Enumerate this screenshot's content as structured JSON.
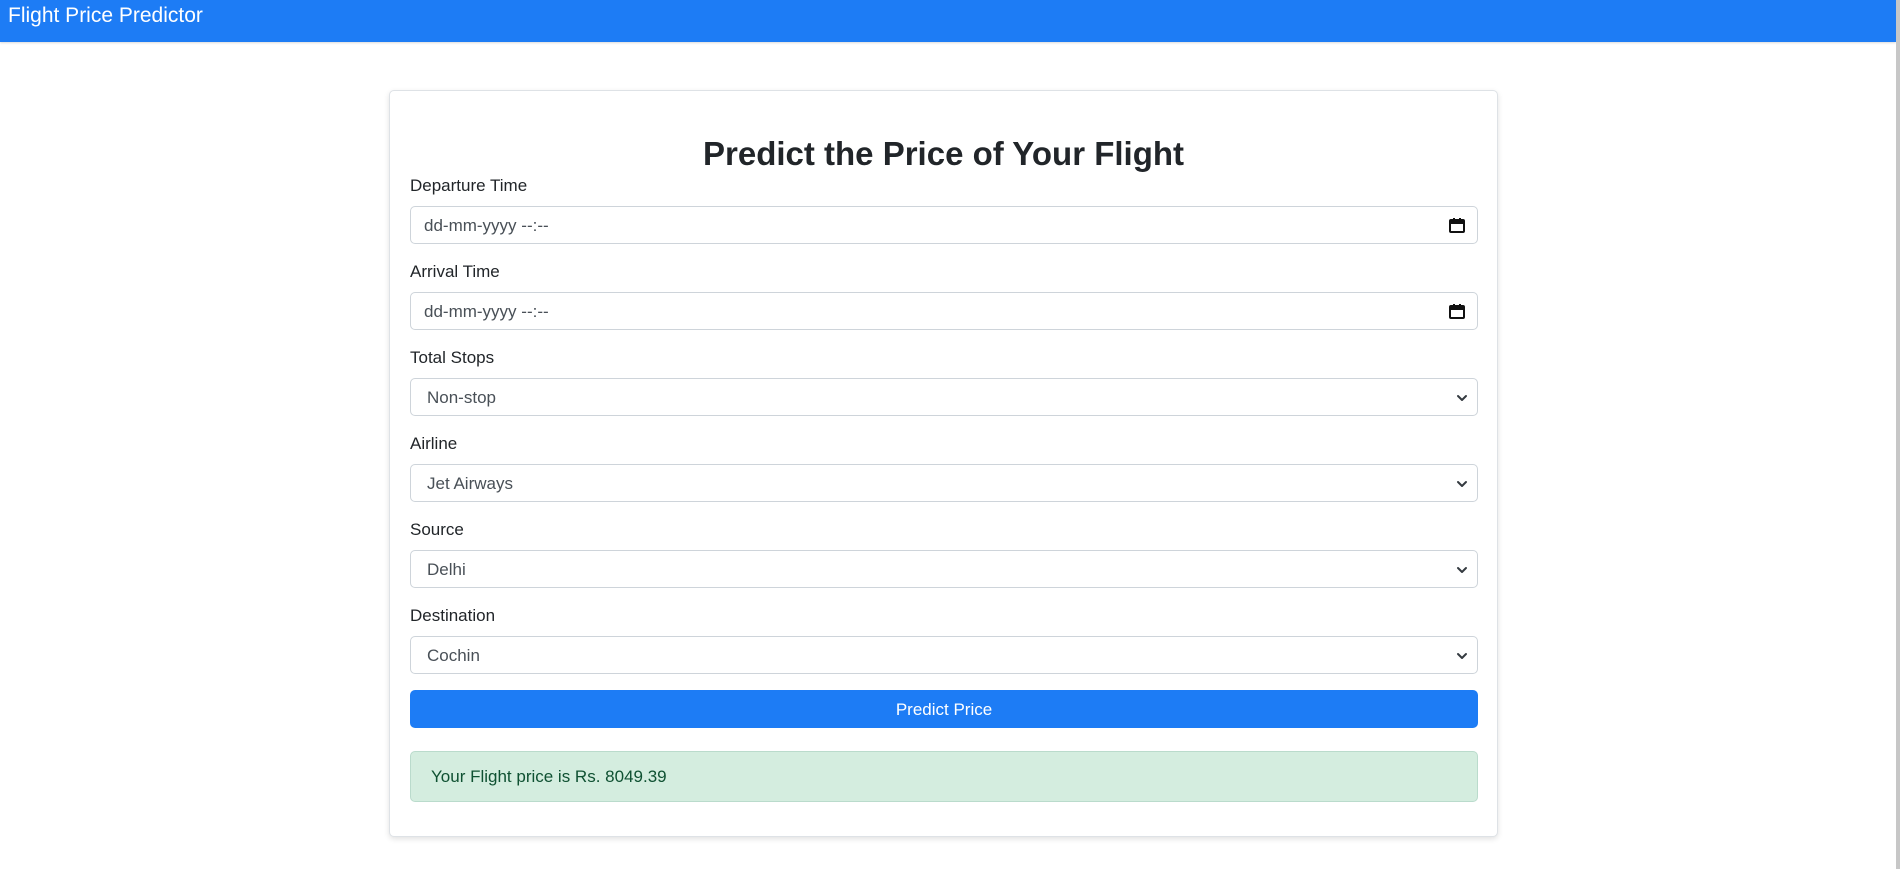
{
  "app": {
    "brand": "Flight Price Predictor"
  },
  "form": {
    "title": "Predict the Price of Your Flight",
    "departure": {
      "label": "Departure Time",
      "value": "dd-mm-yyyy --:--"
    },
    "arrival": {
      "label": "Arrival Time",
      "value": "dd-mm-yyyy --:--"
    },
    "stops": {
      "label": "Total Stops",
      "selected": "Non-stop"
    },
    "airline": {
      "label": "Airline",
      "selected": "Jet Airways"
    },
    "source": {
      "label": "Source",
      "selected": "Delhi"
    },
    "destination": {
      "label": "Destination",
      "selected": "Cochin"
    },
    "submit_label": "Predict Price"
  },
  "result": {
    "message": "Your Flight price is Rs. 8049.39"
  },
  "icons": {
    "date_picker": "calendar-icon",
    "select_arrow": "chevron-down-icon"
  },
  "colors": {
    "primary": "#1d7cf5",
    "success_bg": "#d4eddf",
    "success_text": "#0f5132",
    "border": "#ced4da"
  }
}
